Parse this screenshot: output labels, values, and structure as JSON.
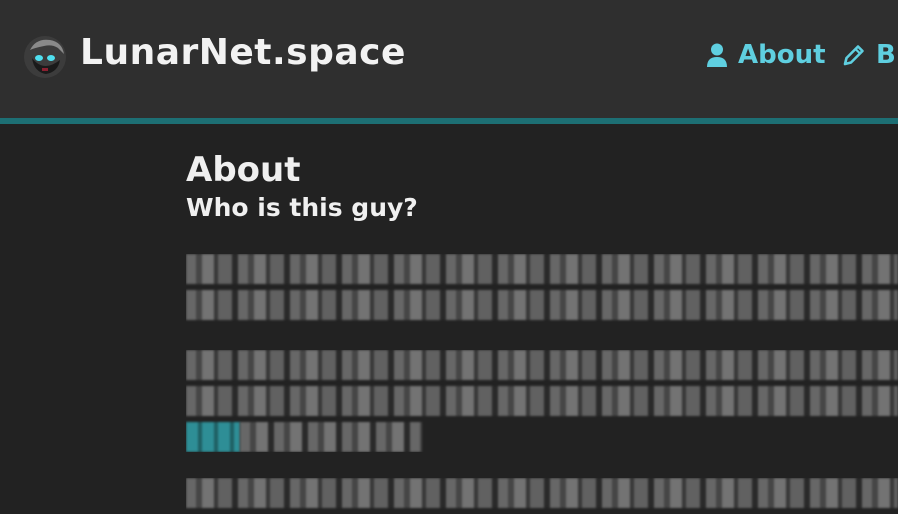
{
  "header": {
    "site_title": "LunarNet.space",
    "nav": [
      {
        "label": "About",
        "icon": "user-icon"
      },
      {
        "label": "Bl",
        "icon": "pencil-icon"
      }
    ],
    "accent_color": "#1d6f74",
    "link_color": "#5fcfe0"
  },
  "main": {
    "title": "About",
    "subtitle": "Who is this guy?"
  }
}
